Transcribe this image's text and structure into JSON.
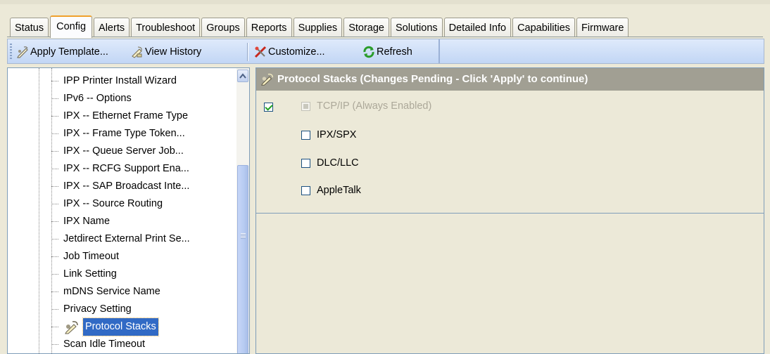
{
  "tabs": [
    {
      "label": "Status"
    },
    {
      "label": "Config",
      "active": true
    },
    {
      "label": "Alerts"
    },
    {
      "label": "Troubleshoot"
    },
    {
      "label": "Groups"
    },
    {
      "label": "Reports"
    },
    {
      "label": "Supplies"
    },
    {
      "label": "Storage"
    },
    {
      "label": "Solutions"
    },
    {
      "label": "Detailed Info"
    },
    {
      "label": "Capabilities"
    },
    {
      "label": "Firmware"
    }
  ],
  "toolbar": {
    "apply_template": "Apply Template...",
    "view_history": "View History",
    "customize": "Customize...",
    "refresh": "Refresh"
  },
  "tree": {
    "items": [
      "IPP Printer Install Wizard",
      "IPv6 -- Options",
      "IPX -- Ethernet Frame Type",
      "IPX -- Frame Type Token...",
      "IPX -- Queue Server Job...",
      "IPX -- RCFG Support Ena...",
      "IPX -- SAP Broadcast Inte...",
      "IPX -- Source Routing",
      "IPX Name",
      "Jetdirect External Print Se...",
      "Job Timeout",
      "Link Setting",
      "mDNS Service Name",
      "Privacy Setting",
      "Protocol Stacks",
      "Scan Idle Timeout"
    ],
    "selected_index": 14
  },
  "panel": {
    "title": "Protocol Stacks (Changes Pending - Click 'Apply' to continue)",
    "enable_checked": true,
    "options": [
      {
        "label": "TCP/IP (Always Enabled)",
        "checked": true,
        "disabled": true
      },
      {
        "label": "IPX/SPX",
        "checked": false,
        "disabled": false
      },
      {
        "label": "DLC/LLC",
        "checked": false,
        "disabled": false
      },
      {
        "label": "AppleTalk",
        "checked": false,
        "disabled": false
      }
    ]
  },
  "colors": {
    "selection": "#316ac5",
    "header_bar": "#a19f93",
    "toolbar": "#c2d6f5",
    "active_tab_accent": "#f0a02c"
  }
}
